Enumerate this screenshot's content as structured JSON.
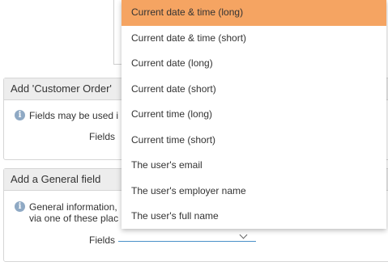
{
  "colors": {
    "highlight": "#f5a462",
    "panel_header_bg": "#ededed",
    "info_icon": "#8fa9c4",
    "select_underline": "#4a90c8"
  },
  "panel_customer": {
    "title": "Add 'Customer Order'",
    "info_text": "Fields may be used i",
    "fields_label": "Fields"
  },
  "panel_general": {
    "title": "Add a General field",
    "info_text": "General information,\nvia one of these plac",
    "fields_label": "Fields",
    "select_value": "",
    "select_icon": "chevron-down-icon"
  },
  "dropdown": {
    "selected_index": 0,
    "items": [
      "Current date & time (long)",
      "Current date & time (short)",
      "Current date (long)",
      "Current date (short)",
      "Current time (long)",
      "Current time (short)",
      "The user's email",
      "The user's employer name",
      "The user's full name"
    ]
  }
}
